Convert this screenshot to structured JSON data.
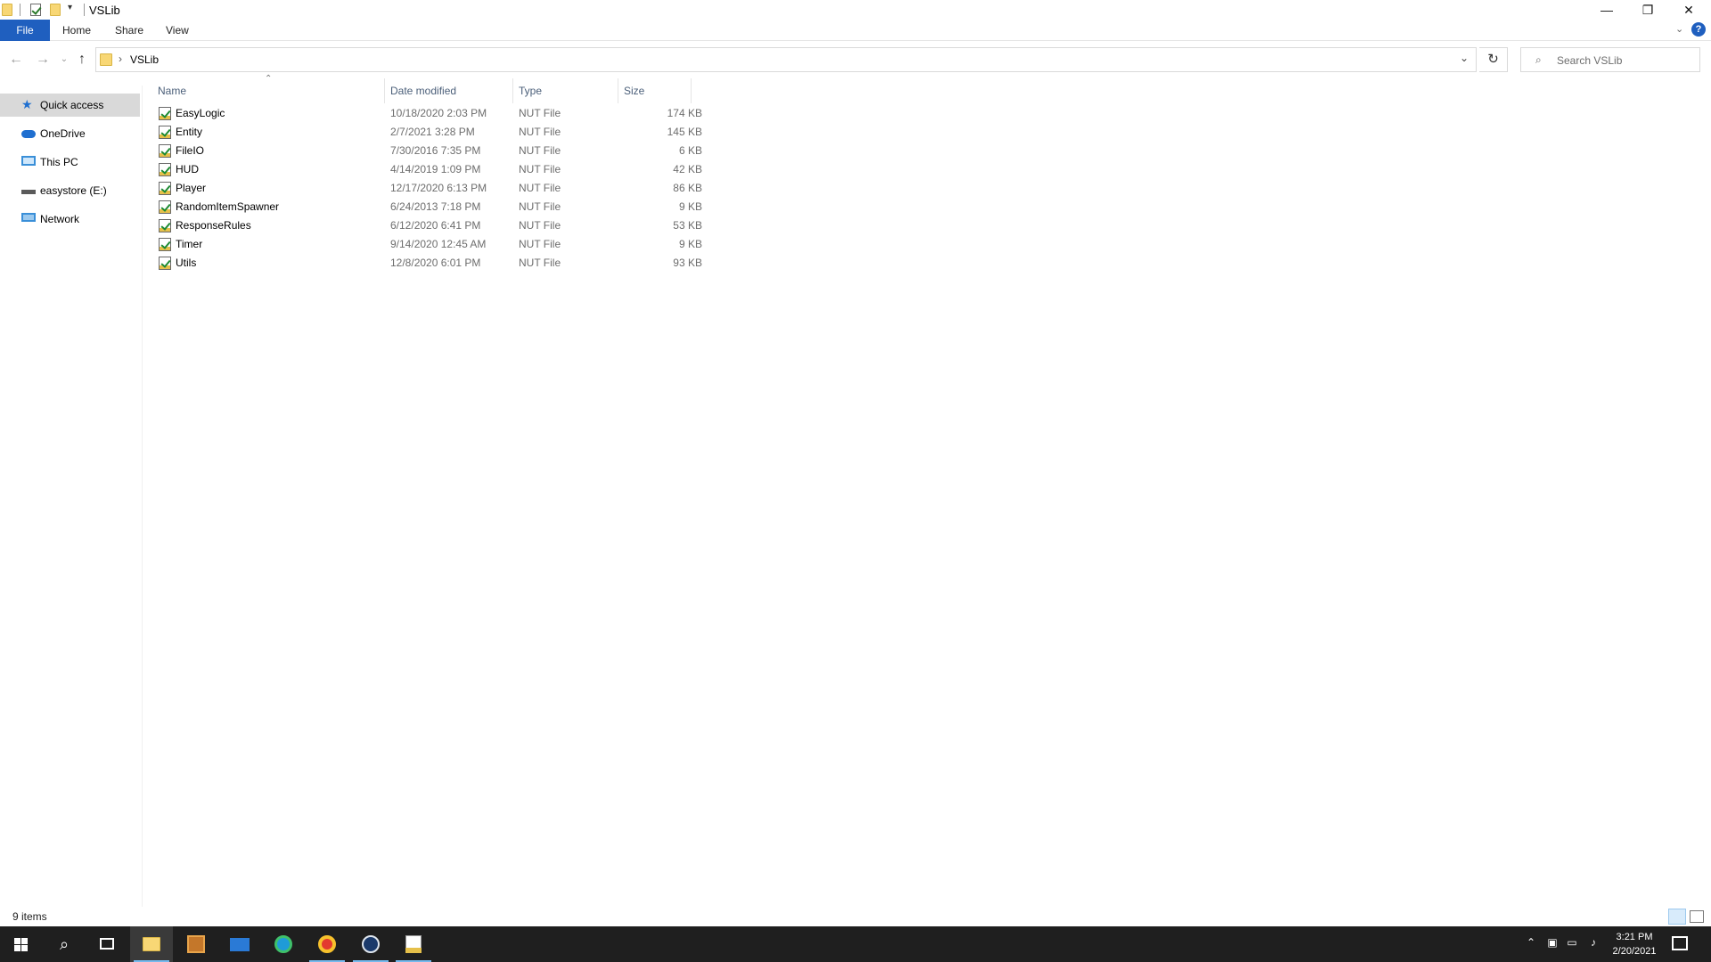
{
  "window": {
    "title": "VSLib",
    "controls": {
      "minimize": "—",
      "restore": "❐",
      "close": "✕"
    }
  },
  "ribbon": {
    "tabs": [
      {
        "label": "File"
      },
      {
        "label": "Home"
      },
      {
        "label": "Share"
      },
      {
        "label": "View"
      }
    ],
    "help": "?"
  },
  "address": {
    "path": "VSLib",
    "separator": "›",
    "search_placeholder": "Search VSLib"
  },
  "nav": {
    "items": [
      {
        "label": "Quick access",
        "icon": "star-icon"
      },
      {
        "label": "OneDrive",
        "icon": "cloud-icon"
      },
      {
        "label": "This PC",
        "icon": "computer-icon"
      },
      {
        "label": "easystore (E:)",
        "icon": "drive-icon"
      },
      {
        "label": "Network",
        "icon": "network-icon"
      }
    ]
  },
  "columns": {
    "name": "Name",
    "date": "Date modified",
    "type": "Type",
    "size": "Size"
  },
  "files": [
    {
      "name": "EasyLogic",
      "date": "10/18/2020 2:03 PM",
      "type": "NUT File",
      "size": "174 KB"
    },
    {
      "name": "Entity",
      "date": "2/7/2021 3:28 PM",
      "type": "NUT File",
      "size": "145 KB"
    },
    {
      "name": "FileIO",
      "date": "7/30/2016 7:35 PM",
      "type": "NUT File",
      "size": "6 KB"
    },
    {
      "name": "HUD",
      "date": "4/14/2019 1:09 PM",
      "type": "NUT File",
      "size": "42 KB"
    },
    {
      "name": "Player",
      "date": "12/17/2020 6:13 PM",
      "type": "NUT File",
      "size": "86 KB"
    },
    {
      "name": "RandomItemSpawner",
      "date": "6/24/2013 7:18 PM",
      "type": "NUT File",
      "size": "9 KB"
    },
    {
      "name": "ResponseRules",
      "date": "6/12/2020 6:41 PM",
      "type": "NUT File",
      "size": "53 KB"
    },
    {
      "name": "Timer",
      "date": "9/14/2020 12:45 AM",
      "type": "NUT File",
      "size": "9 KB"
    },
    {
      "name": "Utils",
      "date": "12/8/2020 6:01 PM",
      "type": "NUT File",
      "size": "93 KB"
    }
  ],
  "status": {
    "items_count": "9 items"
  },
  "taskbar": {
    "time": "3:21 PM",
    "date": "2/20/2021",
    "apps": [
      "start-icon",
      "search-icon",
      "task-view-icon",
      "file-explorer-icon",
      "app-icon",
      "mail-icon",
      "edge-icon",
      "chrome-icon",
      "steam-icon",
      "notepad-icon"
    ]
  },
  "colors": {
    "accent": "#1f5fbf",
    "selection": "#d9d9d9",
    "taskbar": "#1f1f1f"
  }
}
